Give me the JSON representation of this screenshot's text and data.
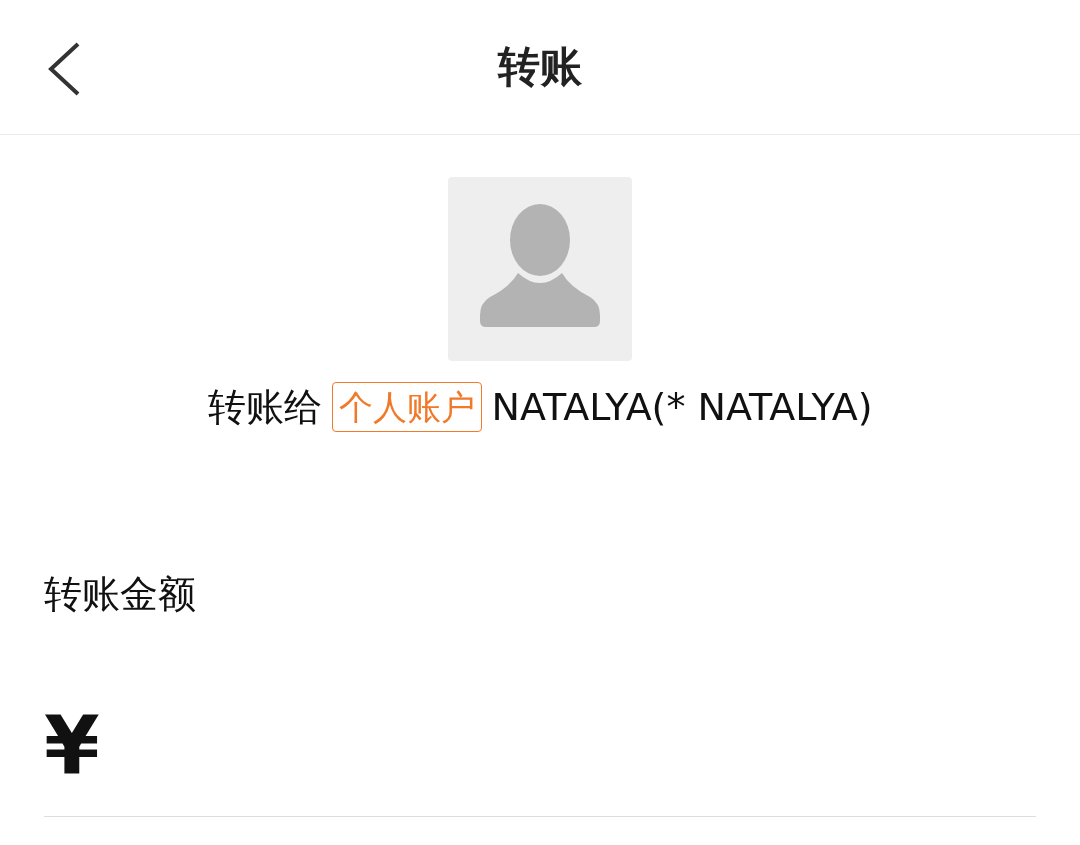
{
  "header": {
    "title": "转账"
  },
  "recipient": {
    "prefix": "转账给",
    "tag": "个人账户",
    "name": "NATALYA(* NATALYA)"
  },
  "amount": {
    "label": "转账金额",
    "currency": "¥"
  }
}
